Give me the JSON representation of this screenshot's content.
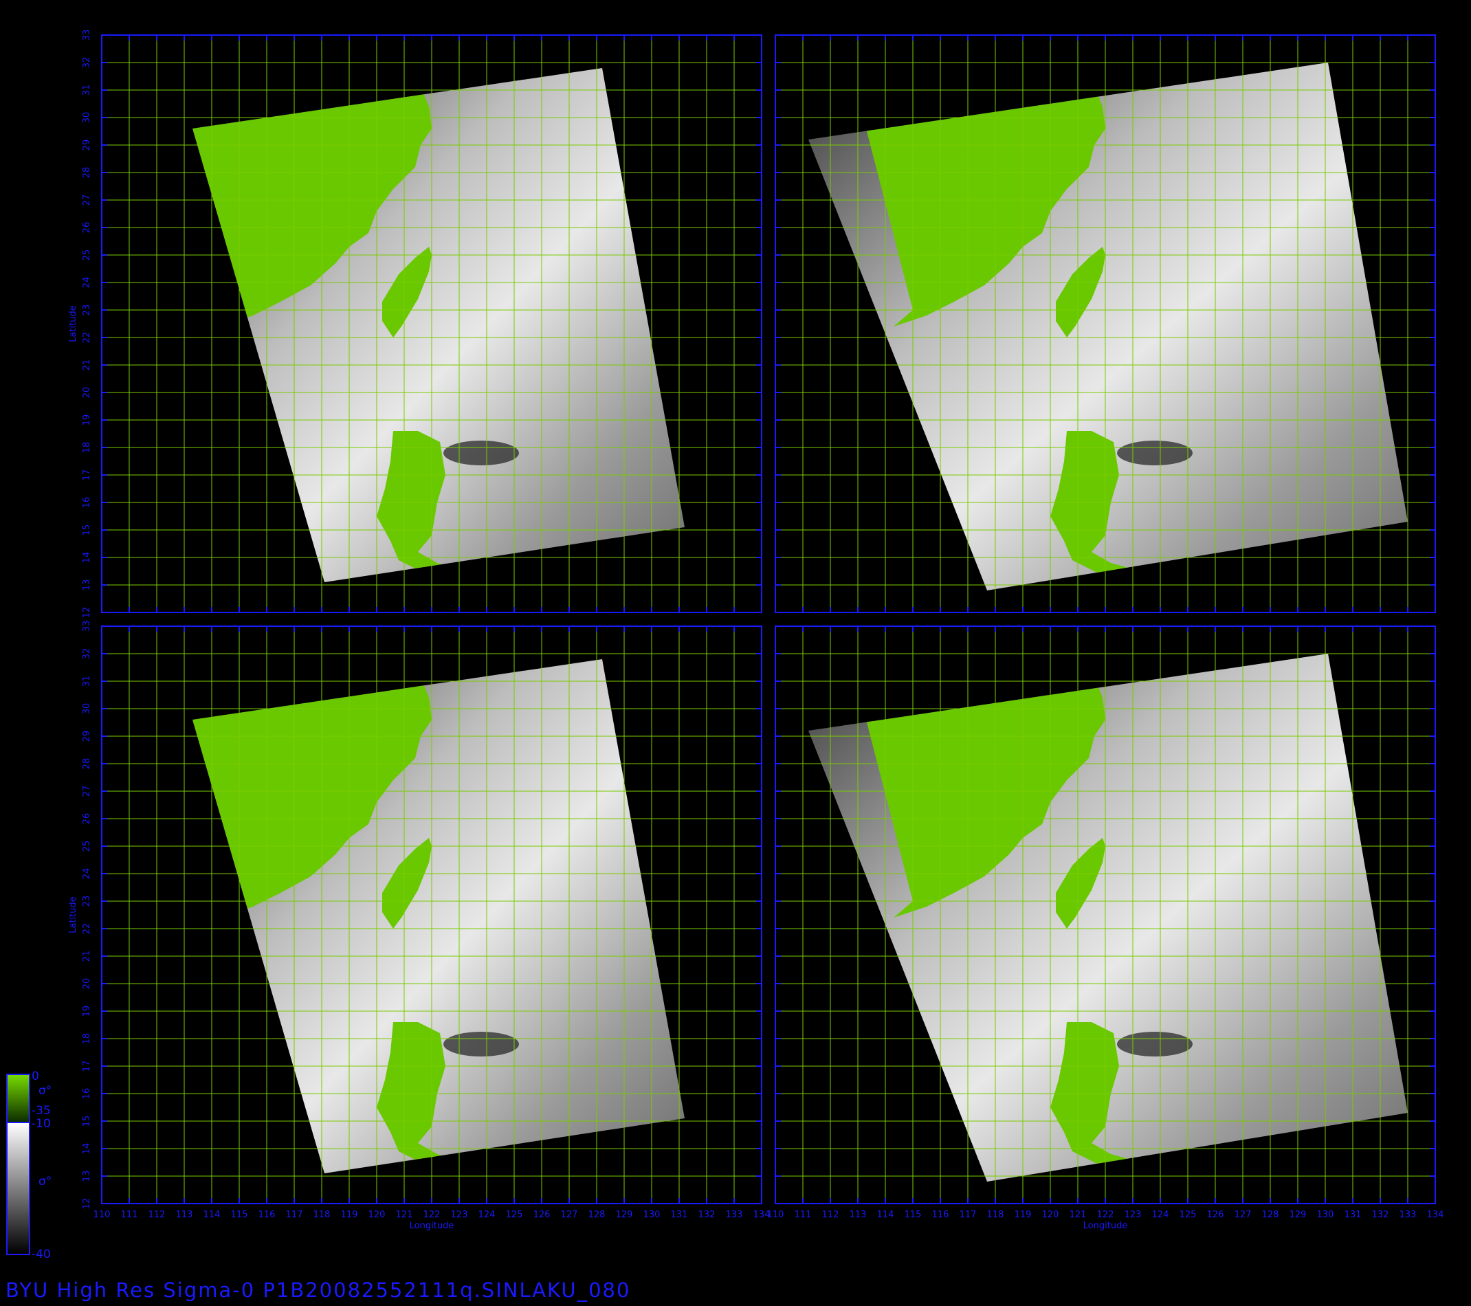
{
  "caption": "BYU High Res Sigma-0 P1B20082552111q.SINLAKU_080",
  "axes": {
    "xlabel": "Longitude",
    "ylabel": "Latitude",
    "lon_range": [
      110,
      134
    ],
    "lat_range": [
      12,
      33
    ],
    "lon_ticks": [
      "110",
      "111",
      "112",
      "113",
      "114",
      "115",
      "116",
      "117",
      "118",
      "119",
      "120",
      "121",
      "122",
      "123",
      "124",
      "125",
      "126",
      "127",
      "128",
      "129",
      "130",
      "131",
      "132",
      "133",
      "134"
    ],
    "lat_ticks": [
      "12",
      "13",
      "14",
      "15",
      "16",
      "17",
      "18",
      "19",
      "20",
      "21",
      "22",
      "23",
      "24",
      "25",
      "26",
      "27",
      "28",
      "29",
      "30",
      "31",
      "32",
      "33"
    ]
  },
  "colorbar": {
    "land": {
      "max": "0",
      "min": "-35",
      "symbol": "σ°"
    },
    "ocean": {
      "max": "-10",
      "min": "-40",
      "symbol": "σ°"
    }
  },
  "colors": {
    "axis": "#1a1aff",
    "grid": "#7acc00",
    "land": "#6ac800",
    "background": "#000000"
  },
  "panels": [
    {
      "name": "panel-top-left",
      "swath": [
        [
          113.3,
          29.6
        ],
        [
          128.2,
          31.8
        ],
        [
          131.2,
          15.1
        ],
        [
          118.1,
          13.1
        ]
      ]
    },
    {
      "name": "panel-top-right",
      "swath": [
        [
          111.2,
          29.2
        ],
        [
          130.1,
          32.0
        ],
        [
          133.0,
          15.3
        ],
        [
          117.7,
          12.8
        ]
      ]
    },
    {
      "name": "panel-bottom-left",
      "swath": [
        [
          113.3,
          29.6
        ],
        [
          128.2,
          31.8
        ],
        [
          131.2,
          15.1
        ],
        [
          118.1,
          13.1
        ]
      ]
    },
    {
      "name": "panel-bottom-right",
      "swath": [
        [
          111.2,
          29.2
        ],
        [
          130.1,
          32.0
        ],
        [
          133.0,
          15.3
        ],
        [
          117.7,
          12.8
        ]
      ]
    }
  ]
}
